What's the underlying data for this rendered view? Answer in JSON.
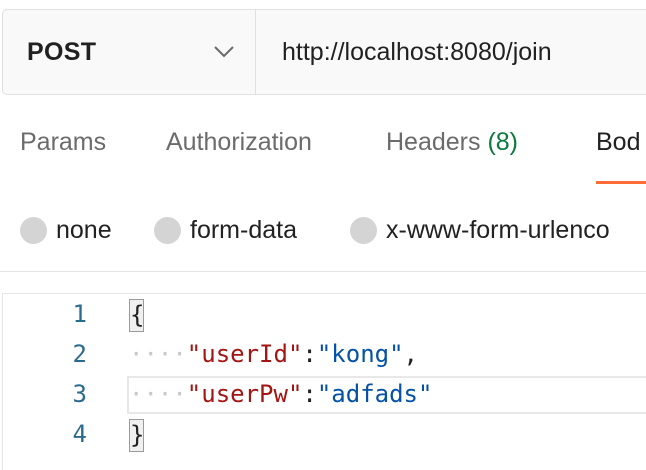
{
  "request": {
    "method": "POST",
    "url": "http://localhost:8080/join"
  },
  "tabs": [
    {
      "label": "Params"
    },
    {
      "label": "Authorization"
    },
    {
      "label": "Headers",
      "count": "(8)"
    },
    {
      "label": "Bod",
      "active": true
    }
  ],
  "body_types": [
    {
      "label": "none"
    },
    {
      "label": "form-data"
    },
    {
      "label": "x-www-form-urlenco"
    }
  ],
  "editor": {
    "lines": [
      {
        "number": "1",
        "open_brace": "{"
      },
      {
        "number": "2",
        "indent": "····",
        "key": "\"userId\"",
        "colon": ":",
        "value": "\"kong\"",
        "comma": ","
      },
      {
        "number": "3",
        "indent": "····",
        "key": "\"userPw\"",
        "colon": ":",
        "value": "\"adfads\""
      },
      {
        "number": "4",
        "close_brace": "}"
      }
    ]
  },
  "colors": {
    "active_tab_underline": "#ff6c37",
    "headers_count": "#0a7a3f",
    "json_key": "#a31515",
    "json_string": "#0451a5",
    "line_number": "#2b6a8f"
  },
  "icons": {
    "method_dropdown": "chevron-down-icon"
  }
}
